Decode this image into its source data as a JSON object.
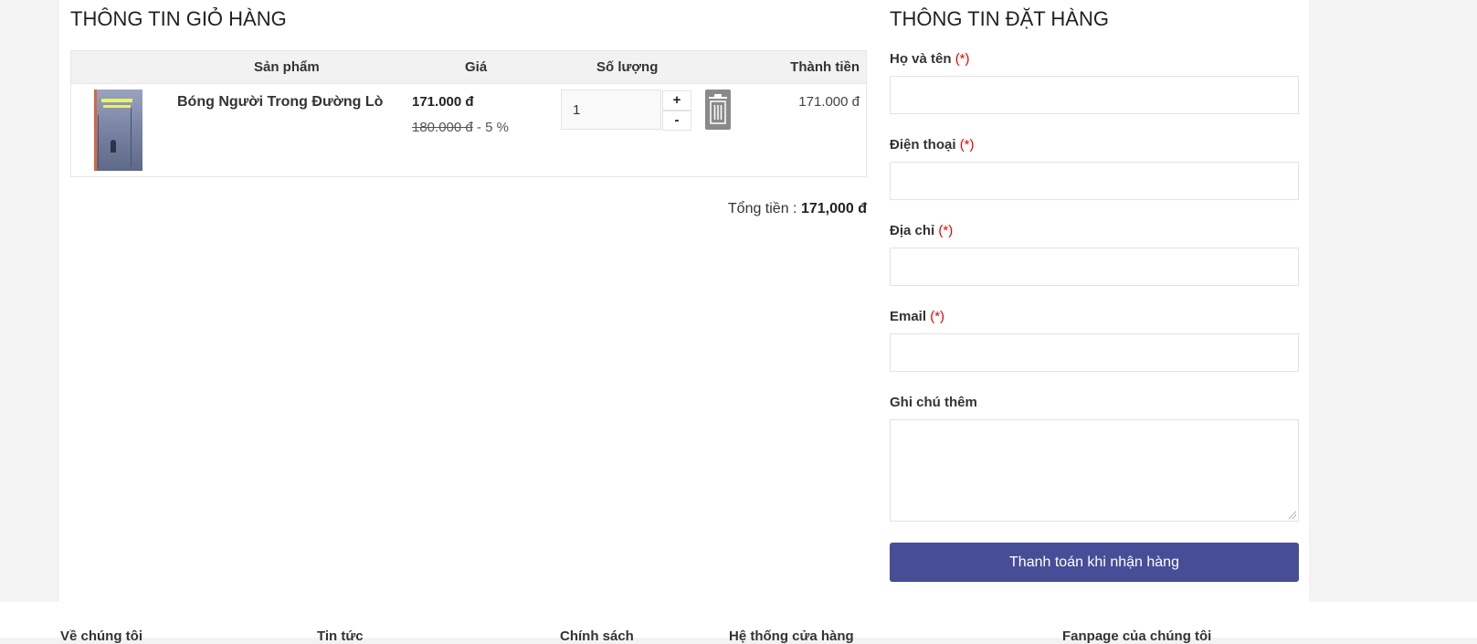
{
  "cart": {
    "title": "THÔNG TIN GIỎ HÀNG",
    "columns": {
      "product": "Sản phẩm",
      "price": "Giá",
      "quantity": "Số lượng",
      "subtotal": "Thành tiền"
    },
    "items": [
      {
        "name": "Bóng Người Trong Đường Lò",
        "price": "171.000 đ",
        "old_price": "180.000 đ",
        "discount": " - 5 %",
        "quantity": "1",
        "line_total": "171.000 đ",
        "plus_label": "+",
        "minus_label": "-"
      }
    ],
    "total_label": "Tổng tiền : ",
    "total_value": "171,000 đ"
  },
  "order": {
    "title": "THÔNG TIN ĐẶT HÀNG",
    "required_mark": "(*)",
    "fields": {
      "name_label": "Họ và tên",
      "phone_label": "Điện thoại",
      "address_label": "Địa chỉ",
      "email_label": "Email",
      "note_label": "Ghi chú thêm"
    },
    "submit_label": "Thanh toán khi nhận hàng"
  },
  "footer": {
    "columns": [
      "Về chúng tôi",
      "Tin tức",
      "Chính sách",
      "Hệ thống cửa hàng",
      "Fanpage của chúng tôi"
    ]
  },
  "colors": {
    "accent": "#474e97",
    "required": "#ee0000",
    "page_background": "#f3f3f3"
  }
}
